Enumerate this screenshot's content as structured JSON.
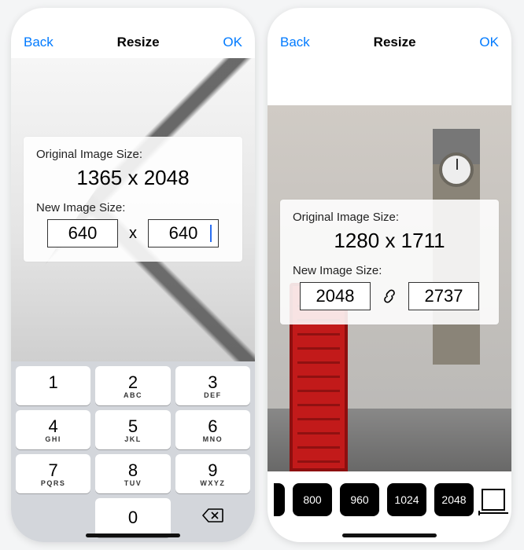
{
  "left": {
    "nav": {
      "back": "Back",
      "title": "Resize",
      "ok": "OK"
    },
    "card": {
      "orig_label": "Original Image Size:",
      "orig_value": "1365 x 2048",
      "new_label": "New Image Size:",
      "width": "640",
      "height": "640",
      "separator": "x"
    },
    "keypad": {
      "k1": "1",
      "k2": "2",
      "k3": "3",
      "k4": "4",
      "k5": "5",
      "k6": "6",
      "k7": "7",
      "k8": "8",
      "k9": "9",
      "k0": "0",
      "s2": "ABC",
      "s3": "DEF",
      "s4": "GHI",
      "s5": "JKL",
      "s6": "MNO",
      "s7": "PQRS",
      "s8": "TUV",
      "s9": "WXYZ"
    }
  },
  "right": {
    "nav": {
      "back": "Back",
      "title": "Resize",
      "ok": "OK"
    },
    "card": {
      "orig_label": "Original Image Size:",
      "orig_value": "1280 x 1711",
      "new_label": "New Image Size:",
      "width": "2048",
      "height": "2737"
    },
    "presets": {
      "p1": "800",
      "p2": "960",
      "p3": "1024",
      "p4": "2048"
    }
  }
}
